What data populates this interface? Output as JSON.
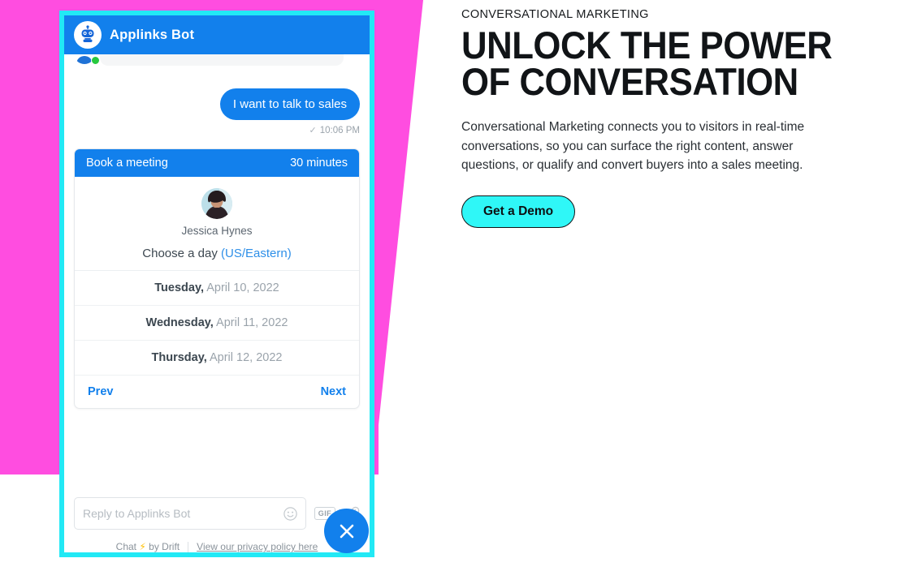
{
  "theme": {
    "magenta": "#ff4de0",
    "cyan_border": "#22e9f5",
    "drift_blue": "#1280ec",
    "cta_cyan": "#2ff7f7"
  },
  "chat": {
    "header": {
      "title": "Applinks Bot",
      "avatar_icon": "robot-icon",
      "status_icon": "online-dot"
    },
    "messages": [
      {
        "direction": "outgoing",
        "text": "I want to talk to sales",
        "status_icon": "check-icon",
        "timestamp": "10:06 PM"
      }
    ],
    "meeting_card": {
      "title": "Book a meeting",
      "duration": "30 minutes",
      "host_name": "Jessica Hynes",
      "host_avatar_icon": "person-photo",
      "prompt": "Choose a day",
      "timezone": "(US/Eastern)",
      "days": [
        {
          "weekday": "Tuesday,",
          "date": " April 10, 2022"
        },
        {
          "weekday": "Wednesday,",
          "date": " April 11, 2022"
        },
        {
          "weekday": "Thursday,",
          "date": " April 12, 2022"
        }
      ],
      "prev_label": "Prev",
      "next_label": "Next"
    },
    "composer": {
      "placeholder": "Reply to Applinks Bot",
      "emoji_icon": "smiley-icon",
      "gif_label": "GIF",
      "attach_icon": "paperclip-icon"
    },
    "footer": {
      "brand_prefix": "Chat",
      "brand_icon": "lightning-bolt-icon",
      "brand_suffix": "by Drift",
      "privacy_link": "View our privacy policy here"
    },
    "close_button_icon": "close-x-icon"
  },
  "marketing": {
    "eyebrow": "CONVERSATIONAL MARKETING",
    "headline": "UNLOCK THE POWER OF CONVERSATION",
    "body": "Conversational Marketing connects you to visitors in real-time conversations, so you can surface the right content, answer questions, or qualify and convert buyers into a sales meeting.",
    "cta_label": "Get a Demo"
  }
}
